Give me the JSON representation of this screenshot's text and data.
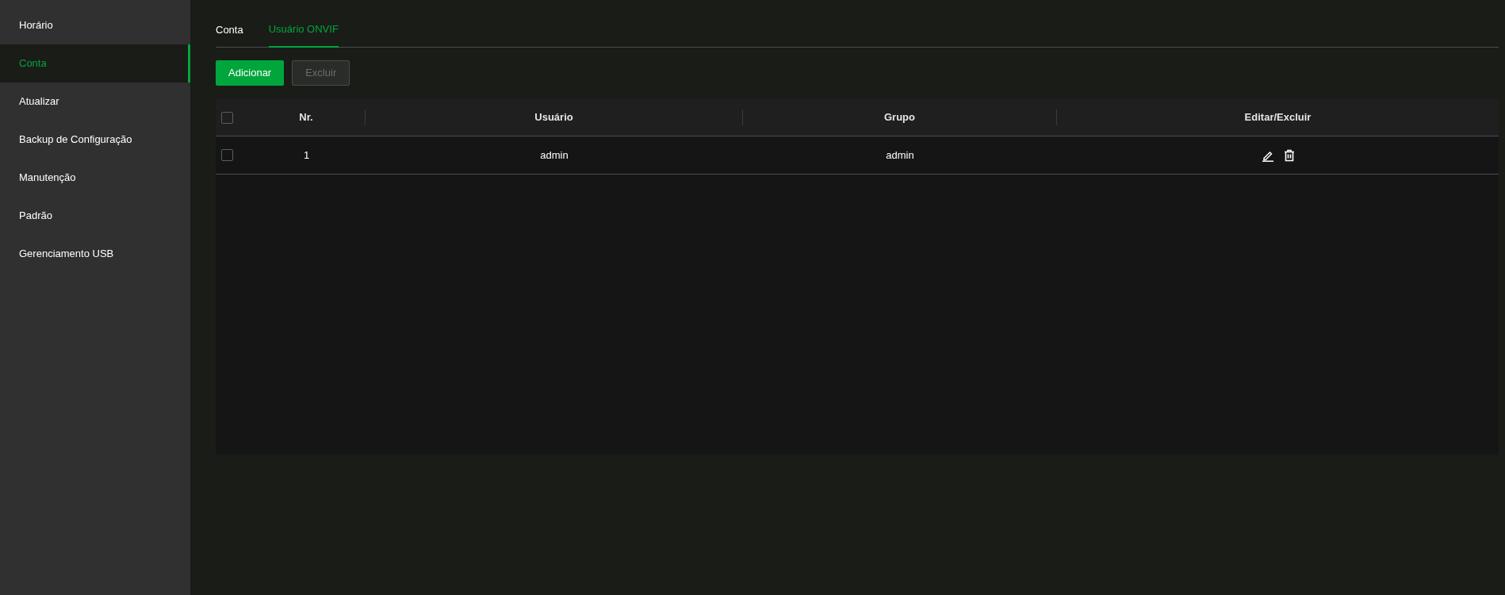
{
  "sidebar": {
    "items": [
      {
        "label": "Horário",
        "selected": false
      },
      {
        "label": "Conta",
        "selected": true
      },
      {
        "label": "Atualizar",
        "selected": false
      },
      {
        "label": "Backup de Configuração",
        "selected": false
      },
      {
        "label": "Manutenção",
        "selected": false
      },
      {
        "label": "Padrão",
        "selected": false
      },
      {
        "label": "Gerenciamento USB",
        "selected": false
      }
    ]
  },
  "tabs": [
    {
      "label": "Conta",
      "selected": false
    },
    {
      "label": "Usuário ONVIF",
      "selected": true
    }
  ],
  "toolbar": {
    "buttons": [
      {
        "label": "Adicionar",
        "disabled": false
      },
      {
        "label": "Excluir",
        "disabled": true
      }
    ]
  },
  "table": {
    "select_all": {
      "checked": false
    },
    "columns": [
      "Nr.",
      "Usuário",
      "Grupo",
      "Editar/Excluir"
    ],
    "rows": [
      {
        "checked": false,
        "cells": [
          "1",
          "admin",
          "admin"
        ]
      }
    ]
  }
}
